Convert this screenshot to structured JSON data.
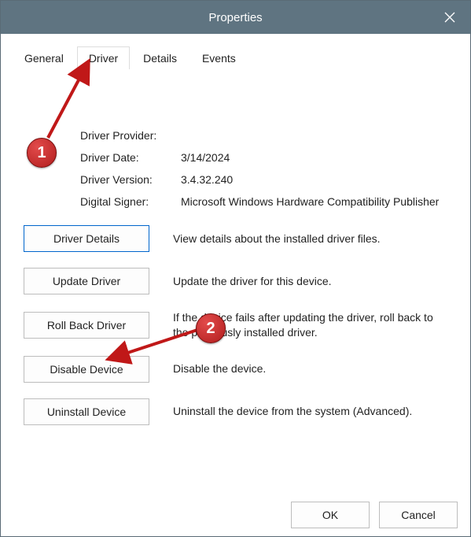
{
  "window": {
    "title": "Properties"
  },
  "tabs": [
    {
      "id": "general",
      "label": "General",
      "active": false
    },
    {
      "id": "driver",
      "label": "Driver",
      "active": true
    },
    {
      "id": "details",
      "label": "Details",
      "active": false
    },
    {
      "id": "events",
      "label": "Events",
      "active": false
    }
  ],
  "driver_info": {
    "provider_label": "Driver Provider:",
    "provider_value": "",
    "date_label": "Driver Date:",
    "date_value": "3/14/2024",
    "version_label": "Driver Version:",
    "version_value": "3.4.32.240",
    "signer_label": "Digital Signer:",
    "signer_value": "Microsoft Windows Hardware Compatibility Publisher"
  },
  "actions": {
    "details": {
      "button": "Driver Details",
      "desc": "View details about the installed driver files."
    },
    "update": {
      "button": "Update Driver",
      "desc": "Update the driver for this device."
    },
    "rollback": {
      "button": "Roll Back Driver",
      "desc": "If the device fails after updating the driver, roll back to the previously installed driver."
    },
    "disable": {
      "button": "Disable Device",
      "desc": "Disable the device."
    },
    "uninstall": {
      "button": "Uninstall Device",
      "desc": "Uninstall the device from the system (Advanced)."
    }
  },
  "footer": {
    "ok": "OK",
    "cancel": "Cancel"
  },
  "annotations": {
    "callout1": "1",
    "callout2": "2"
  }
}
